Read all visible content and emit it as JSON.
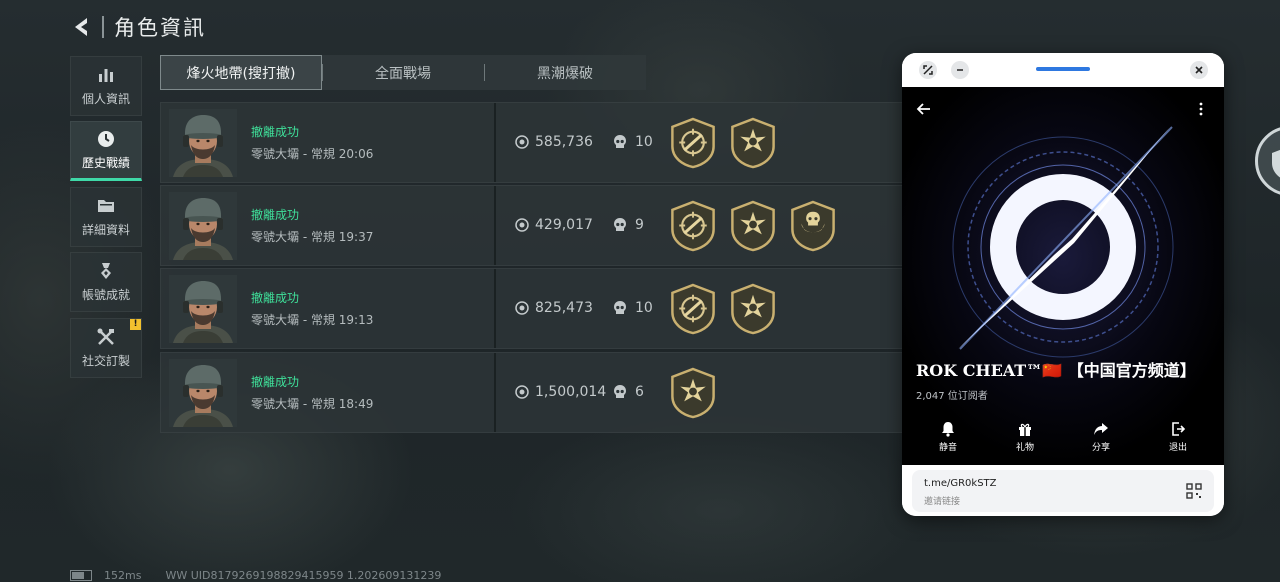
{
  "header": {
    "title": "角色資訊"
  },
  "nav": {
    "items": [
      {
        "label": "個人資訊",
        "icon": "bar-chart-icon",
        "active": false
      },
      {
        "label": "歷史戰績",
        "icon": "clock-icon",
        "active": true
      },
      {
        "label": "詳細資料",
        "icon": "folder-icon",
        "active": false
      },
      {
        "label": "帳號成就",
        "icon": "medal-icon",
        "active": false
      },
      {
        "label": "社交訂製",
        "icon": "tools-icon",
        "active": false,
        "badge": "!"
      }
    ]
  },
  "tabs": [
    {
      "label": "烽火地帶(搜打撤)",
      "active": true
    },
    {
      "label": "全面戰場",
      "active": false
    },
    {
      "label": "黑潮爆破",
      "active": false
    }
  ],
  "matches": [
    {
      "status": "撤離成功",
      "map": "零號大壩 - 常規 20:06",
      "value": "585,736",
      "kills": "10",
      "medals": [
        "target-medal-icon",
        "star-medal-icon"
      ]
    },
    {
      "status": "撤離成功",
      "map": "零號大壩 - 常規 19:37",
      "value": "429,017",
      "kills": "9",
      "medals": [
        "target-medal-icon",
        "star-medal-icon",
        "skull-medal-icon"
      ]
    },
    {
      "status": "撤離成功",
      "map": "零號大壩 - 常規 19:13",
      "value": "825,473",
      "kills": "10",
      "medals": [
        "target-medal-icon",
        "star-medal-icon"
      ]
    },
    {
      "status": "撤離成功",
      "map": "零號大壩 - 常規 18:49",
      "value": "1,500,014",
      "kills": "6",
      "medals": [
        "star-medal-icon"
      ]
    }
  ],
  "footer": {
    "ping": "152ms",
    "uid": "WW UID8179269198829415959 1.202609131239"
  },
  "popup": {
    "title": "ROK CHEAT™🇨🇳 【中国官方频道】",
    "subscribers": "2,047 位订阅者",
    "actions": [
      {
        "label": "静音",
        "icon": "bell-icon"
      },
      {
        "label": "礼物",
        "icon": "gift-icon"
      },
      {
        "label": "分享",
        "icon": "share-icon"
      },
      {
        "label": "退出",
        "icon": "exit-icon"
      }
    ],
    "link": "t.me/GR0kSTZ",
    "link_label": "邀请链接",
    "accent": "#2e78e0"
  },
  "colors": {
    "success": "#3fe09a",
    "active_underline": "#3fd9a8",
    "badge": "#f2c12e"
  }
}
